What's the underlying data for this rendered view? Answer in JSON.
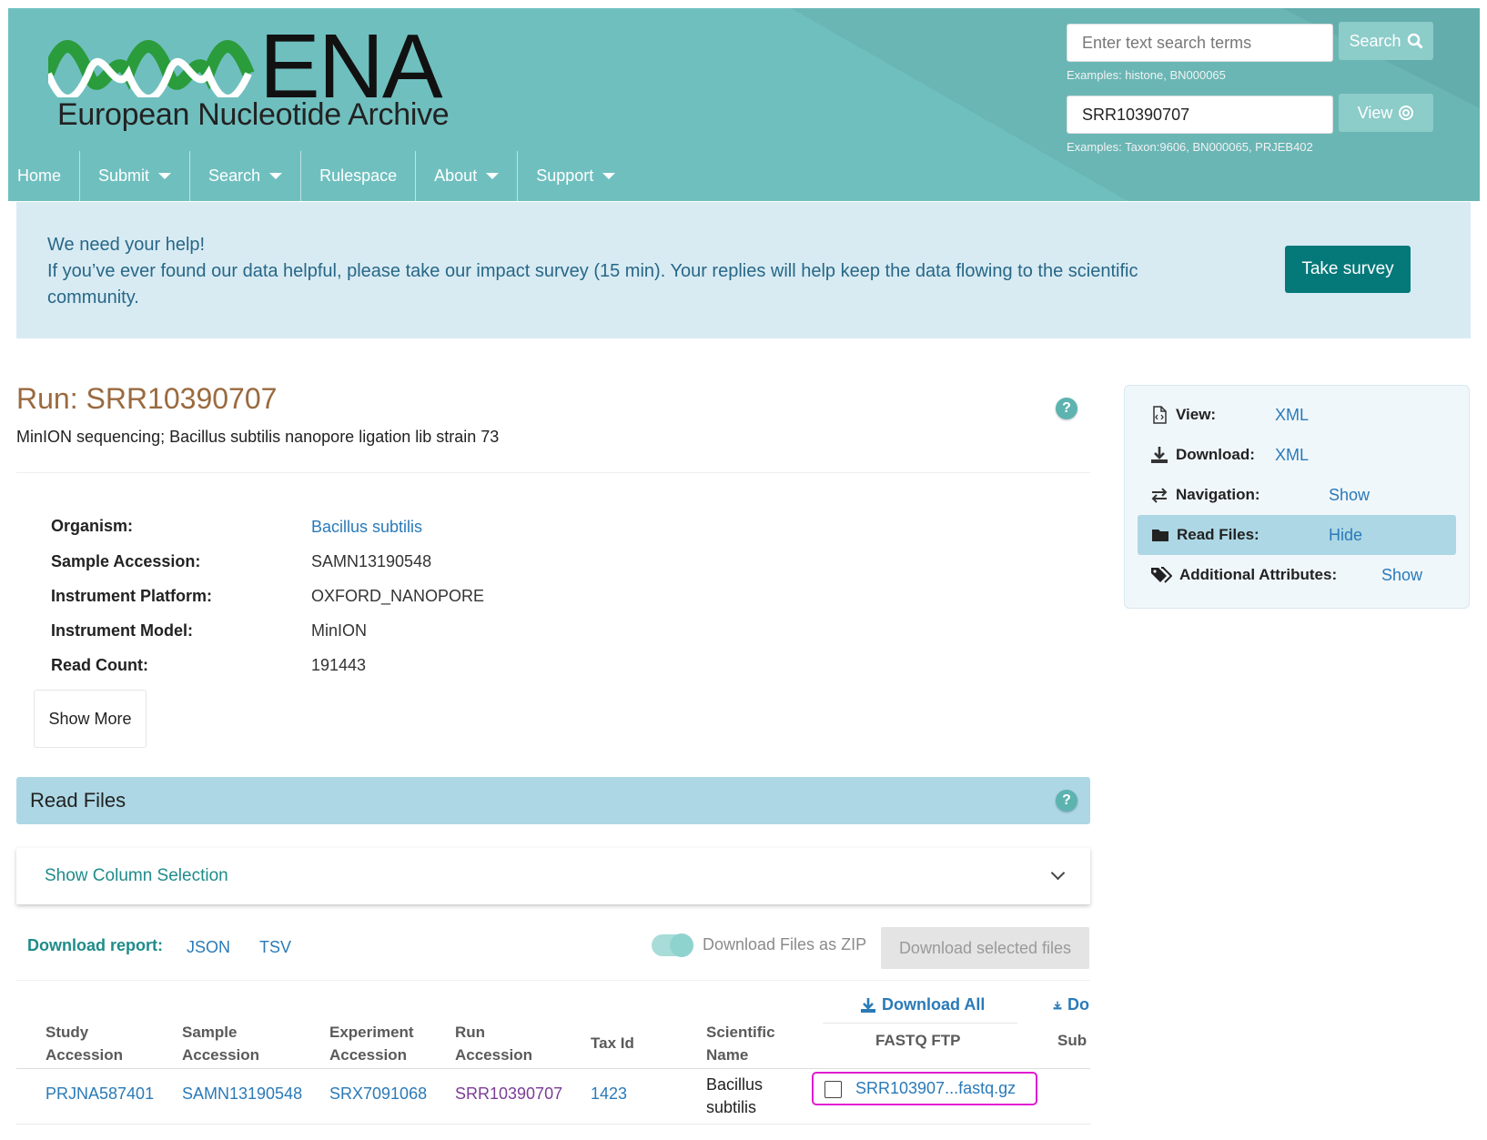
{
  "header": {
    "logo_text": "ENA",
    "logo_subtitle": "European Nucleotide Archive",
    "search": {
      "placeholder": "Enter text search terms",
      "button_label": "Search",
      "examples": "Examples: histone, BN000065"
    },
    "view": {
      "value": "SRR10390707",
      "button_label": "View",
      "examples": "Examples: Taxon:9606, BN000065, PRJEB402"
    },
    "nav": [
      {
        "label": "Home",
        "dropdown": false
      },
      {
        "label": "Submit",
        "dropdown": true
      },
      {
        "label": "Search",
        "dropdown": true
      },
      {
        "label": "Rulespace",
        "dropdown": false
      },
      {
        "label": "About",
        "dropdown": true
      },
      {
        "label": "Support",
        "dropdown": true
      }
    ]
  },
  "banner": {
    "line1": "We need your help!",
    "line2": "If you’ve ever found our data helpful, please take our impact survey (15 min). Your replies will help keep the data flowing to the scientific community.",
    "button": "Take survey"
  },
  "run": {
    "title": "Run: SRR10390707",
    "description": "MinION sequencing; Bacillus subtilis nanopore ligation lib strain 73",
    "help_icon": "?",
    "attributes": [
      {
        "label": "Organism:",
        "value": "Bacillus subtilis",
        "link": true
      },
      {
        "label": "Sample Accession:",
        "value": "SAMN13190548",
        "link": false
      },
      {
        "label": "Instrument Platform:",
        "value": "OXFORD_NANOPORE",
        "link": false
      },
      {
        "label": "Instrument Model:",
        "value": "MinION",
        "link": false
      },
      {
        "label": "Read Count:",
        "value": "191443",
        "link": false
      }
    ],
    "show_more": "Show More"
  },
  "read_files": {
    "title": "Read Files",
    "column_selection": "Show Column Selection",
    "download_report_label": "Download report:",
    "report_formats": [
      "JSON",
      "TSV"
    ],
    "zip_toggle_label": "Download Files as ZIP",
    "download_selected": "Download selected files",
    "download_all": "Download All",
    "download_all_cut": "Do",
    "columns": {
      "study_1": "Study",
      "study_2": "Accession",
      "sample_1": "Sample",
      "sample_2": "Accession",
      "experiment_1": "Experiment",
      "experiment_2": "Accession",
      "run_1": "Run",
      "run_2": "Accession",
      "tax_id": "Tax Id",
      "sci_1": "Scientific",
      "sci_2": "Name",
      "fastq_ftp": "FASTQ FTP",
      "sub_cut": "Sub"
    },
    "row": {
      "study_accession": "PRJNA587401",
      "sample_accession": "SAMN13190548",
      "experiment_accession": "SRX7091068",
      "run_accession": "SRR10390707",
      "tax_id": "1423",
      "sci_name_1": "Bacillus",
      "sci_name_2": "subtilis",
      "fastq_ftp": "SRR103907...fastq.gz"
    }
  },
  "side_panel": {
    "rows": [
      {
        "icon": "file-code-icon",
        "label": "View:",
        "link": "XML"
      },
      {
        "icon": "download-icon",
        "label": "Download:",
        "link": "XML"
      },
      {
        "icon": "exchange-icon",
        "label": "Navigation:",
        "link": "Show"
      },
      {
        "icon": "folder-icon",
        "label": "Read Files:",
        "link": "Hide"
      },
      {
        "icon": "tags-icon",
        "label": "Additional Attributes:",
        "link": "Show"
      }
    ]
  },
  "colors": {
    "header_teal": "#70bfbf",
    "banner_bg": "#d8ebf3",
    "survey_button": "#05787a",
    "run_title": "#9a6a3f",
    "link": "#2a7ab8",
    "section_header": "#add7e5",
    "highlight_box": "#e11bd1"
  }
}
